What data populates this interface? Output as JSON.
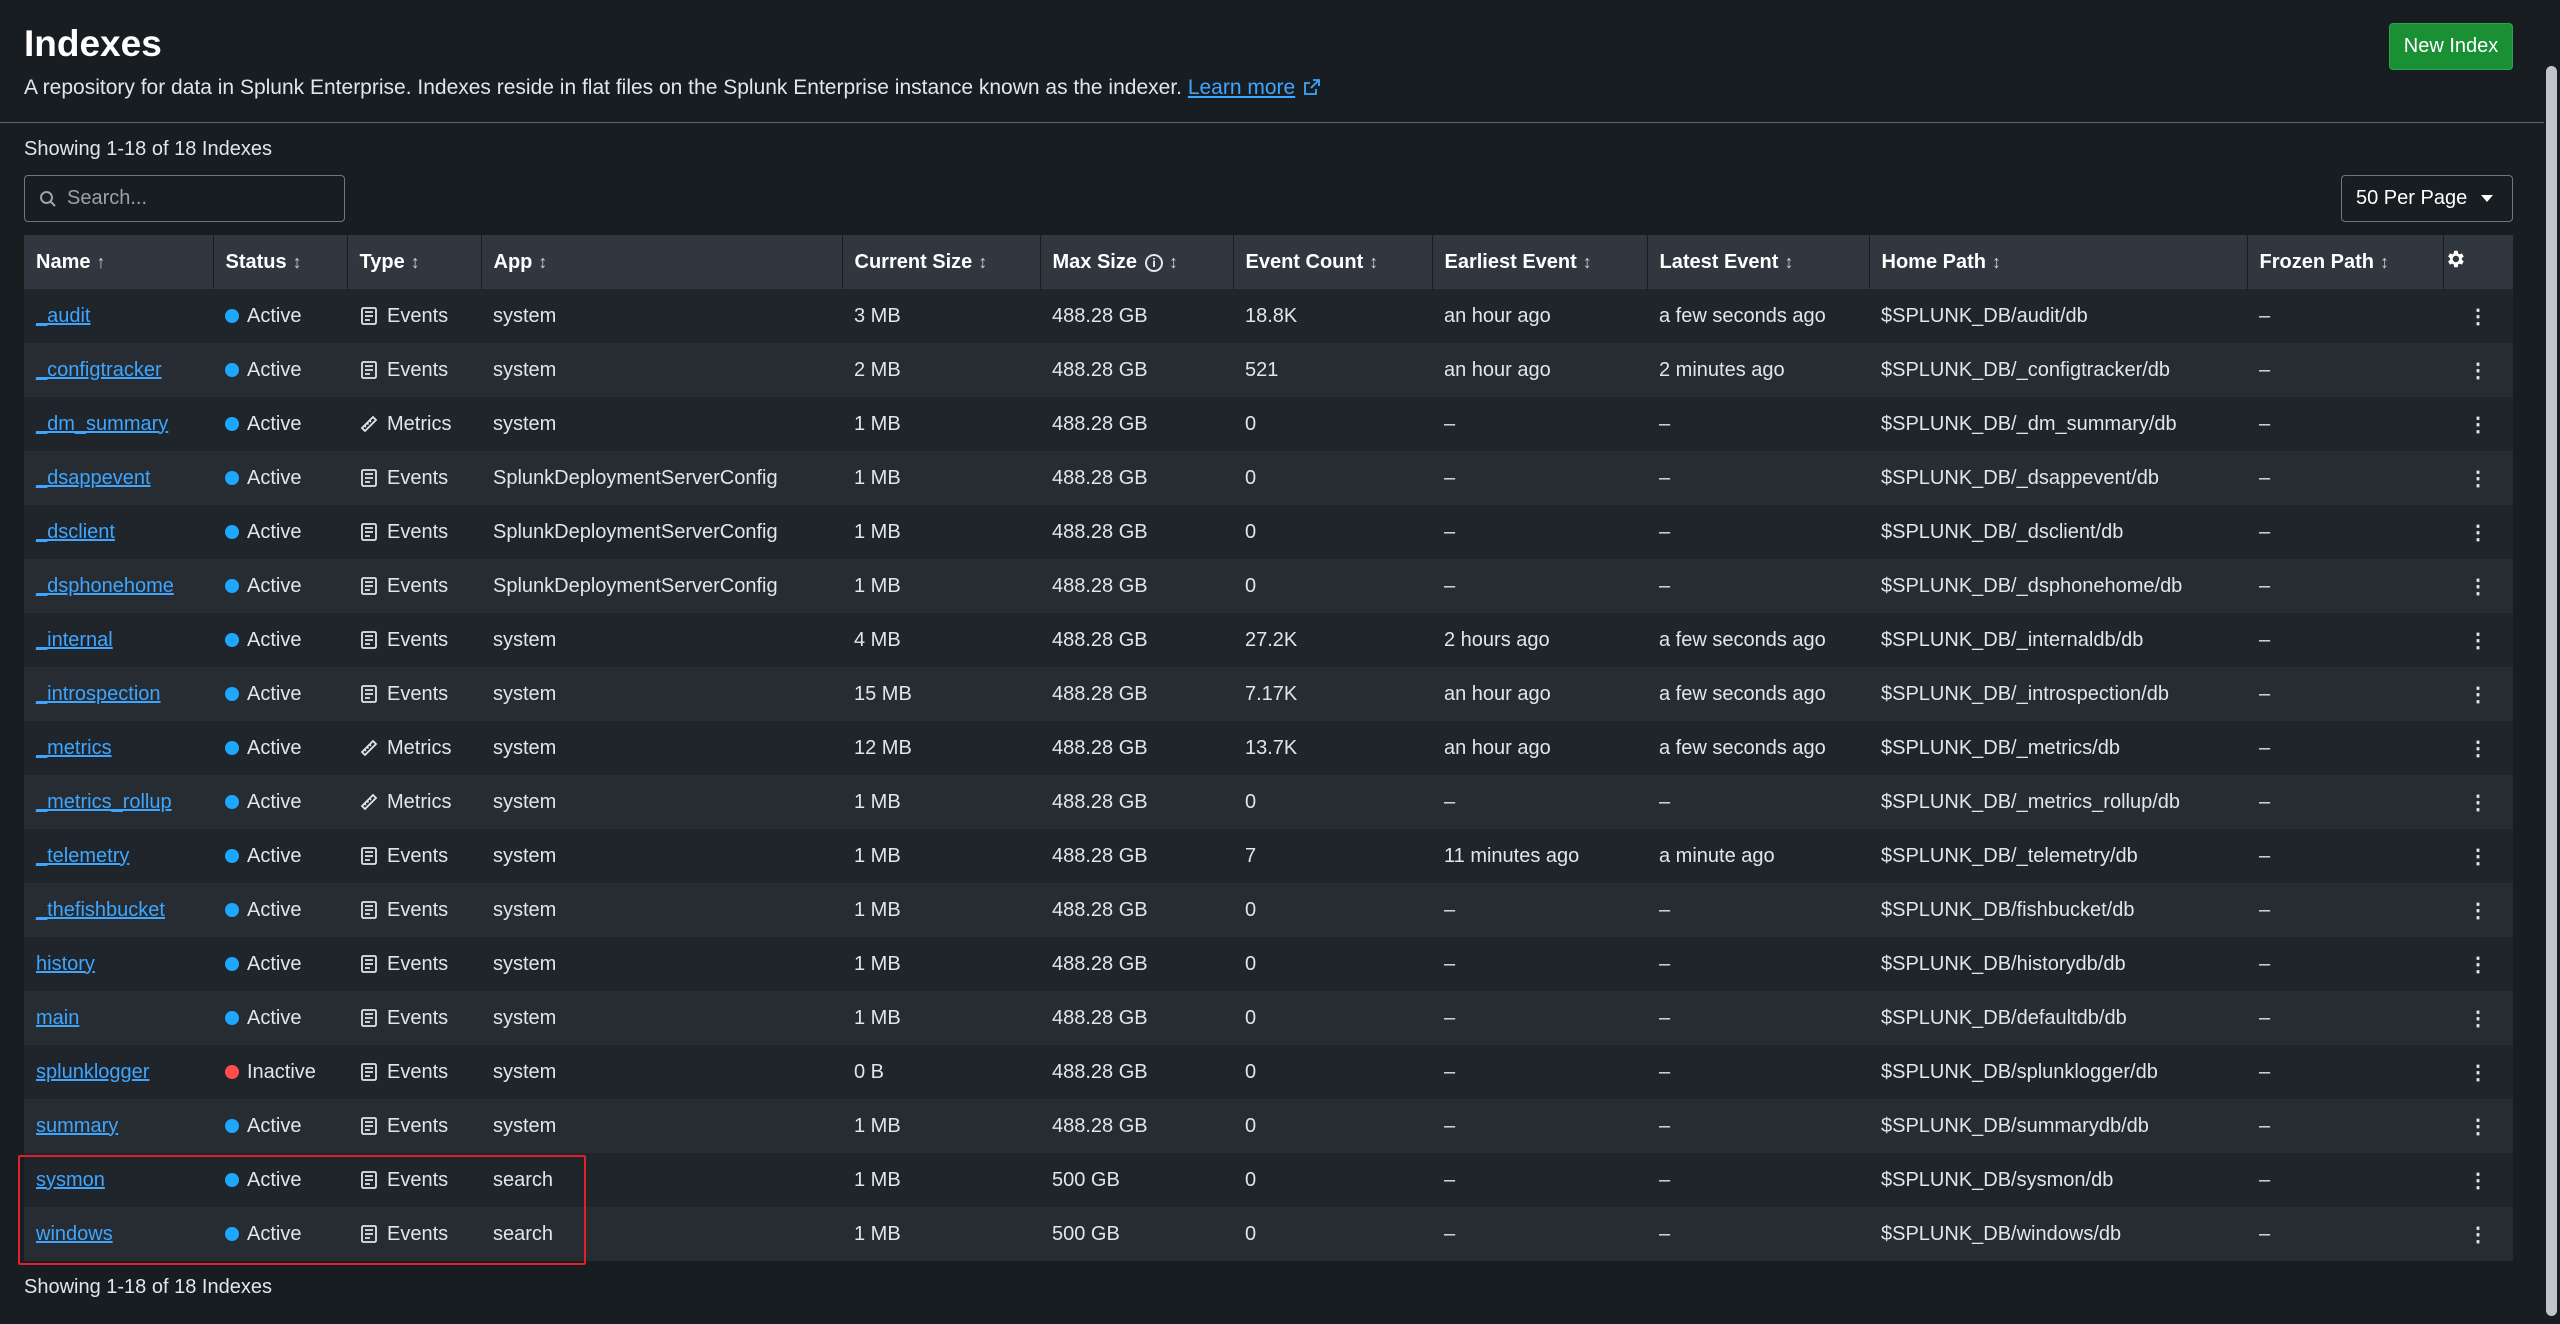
{
  "header": {
    "title": "Indexes",
    "subtitle": "A repository for data in Splunk Enterprise. Indexes reside in flat files on the Splunk Enterprise instance known as the indexer.",
    "learn_more": "Learn more",
    "new_index_label": "New Index"
  },
  "showing_text": "Showing 1-18 of 18 Indexes",
  "search": {
    "placeholder": "Search...",
    "value": ""
  },
  "per_page": {
    "selected": "50 Per Page"
  },
  "columns": {
    "name": "Name",
    "status": "Status",
    "type": "Type",
    "app": "App",
    "current_size": "Current Size",
    "max_size": "Max Size",
    "event_count": "Event Count",
    "earliest_event": "Earliest Event",
    "latest_event": "Latest Event",
    "home_path": "Home Path",
    "frozen_path": "Frozen Path"
  },
  "rows": [
    {
      "name": "_audit",
      "status": "Active",
      "type": "Events",
      "app": "system",
      "current_size": "3 MB",
      "max_size": "488.28 GB",
      "event_count": "18.8K",
      "earliest": "an hour ago",
      "latest": "a few seconds ago",
      "home_path": "$SPLUNK_DB/audit/db",
      "frozen_path": "–"
    },
    {
      "name": "_configtracker",
      "status": "Active",
      "type": "Events",
      "app": "system",
      "current_size": "2 MB",
      "max_size": "488.28 GB",
      "event_count": "521",
      "earliest": "an hour ago",
      "latest": "2 minutes ago",
      "home_path": "$SPLUNK_DB/_configtracker/db",
      "frozen_path": "–"
    },
    {
      "name": "_dm_summary",
      "status": "Active",
      "type": "Metrics",
      "app": "system",
      "current_size": "1 MB",
      "max_size": "488.28 GB",
      "event_count": "0",
      "earliest": "–",
      "latest": "–",
      "home_path": "$SPLUNK_DB/_dm_summary/db",
      "frozen_path": "–"
    },
    {
      "name": "_dsappevent",
      "status": "Active",
      "type": "Events",
      "app": "SplunkDeploymentServerConfig",
      "current_size": "1 MB",
      "max_size": "488.28 GB",
      "event_count": "0",
      "earliest": "–",
      "latest": "–",
      "home_path": "$SPLUNK_DB/_dsappevent/db",
      "frozen_path": "–"
    },
    {
      "name": "_dsclient",
      "status": "Active",
      "type": "Events",
      "app": "SplunkDeploymentServerConfig",
      "current_size": "1 MB",
      "max_size": "488.28 GB",
      "event_count": "0",
      "earliest": "–",
      "latest": "–",
      "home_path": "$SPLUNK_DB/_dsclient/db",
      "frozen_path": "–"
    },
    {
      "name": "_dsphonehome",
      "status": "Active",
      "type": "Events",
      "app": "SplunkDeploymentServerConfig",
      "current_size": "1 MB",
      "max_size": "488.28 GB",
      "event_count": "0",
      "earliest": "–",
      "latest": "–",
      "home_path": "$SPLUNK_DB/_dsphonehome/db",
      "frozen_path": "–"
    },
    {
      "name": "_internal",
      "status": "Active",
      "type": "Events",
      "app": "system",
      "current_size": "4 MB",
      "max_size": "488.28 GB",
      "event_count": "27.2K",
      "earliest": "2 hours ago",
      "latest": "a few seconds ago",
      "home_path": "$SPLUNK_DB/_internaldb/db",
      "frozen_path": "–"
    },
    {
      "name": "_introspection",
      "status": "Active",
      "type": "Events",
      "app": "system",
      "current_size": "15 MB",
      "max_size": "488.28 GB",
      "event_count": "7.17K",
      "earliest": "an hour ago",
      "latest": "a few seconds ago",
      "home_path": "$SPLUNK_DB/_introspection/db",
      "frozen_path": "–"
    },
    {
      "name": "_metrics",
      "status": "Active",
      "type": "Metrics",
      "app": "system",
      "current_size": "12 MB",
      "max_size": "488.28 GB",
      "event_count": "13.7K",
      "earliest": "an hour ago",
      "latest": "a few seconds ago",
      "home_path": "$SPLUNK_DB/_metrics/db",
      "frozen_path": "–"
    },
    {
      "name": "_metrics_rollup",
      "status": "Active",
      "type": "Metrics",
      "app": "system",
      "current_size": "1 MB",
      "max_size": "488.28 GB",
      "event_count": "0",
      "earliest": "–",
      "latest": "–",
      "home_path": "$SPLUNK_DB/_metrics_rollup/db",
      "frozen_path": "–"
    },
    {
      "name": "_telemetry",
      "status": "Active",
      "type": "Events",
      "app": "system",
      "current_size": "1 MB",
      "max_size": "488.28 GB",
      "event_count": "7",
      "earliest": "11 minutes ago",
      "latest": "a minute ago",
      "home_path": "$SPLUNK_DB/_telemetry/db",
      "frozen_path": "–"
    },
    {
      "name": "_thefishbucket",
      "status": "Active",
      "type": "Events",
      "app": "system",
      "current_size": "1 MB",
      "max_size": "488.28 GB",
      "event_count": "0",
      "earliest": "–",
      "latest": "–",
      "home_path": "$SPLUNK_DB/fishbucket/db",
      "frozen_path": "–"
    },
    {
      "name": "history",
      "status": "Active",
      "type": "Events",
      "app": "system",
      "current_size": "1 MB",
      "max_size": "488.28 GB",
      "event_count": "0",
      "earliest": "–",
      "latest": "–",
      "home_path": "$SPLUNK_DB/historydb/db",
      "frozen_path": "–"
    },
    {
      "name": "main",
      "status": "Active",
      "type": "Events",
      "app": "system",
      "current_size": "1 MB",
      "max_size": "488.28 GB",
      "event_count": "0",
      "earliest": "–",
      "latest": "–",
      "home_path": "$SPLUNK_DB/defaultdb/db",
      "frozen_path": "–"
    },
    {
      "name": "splunklogger",
      "status": "Inactive",
      "type": "Events",
      "app": "system",
      "current_size": "0 B",
      "max_size": "488.28 GB",
      "event_count": "0",
      "earliest": "–",
      "latest": "–",
      "home_path": "$SPLUNK_DB/splunklogger/db",
      "frozen_path": "–"
    },
    {
      "name": "summary",
      "status": "Active",
      "type": "Events",
      "app": "system",
      "current_size": "1 MB",
      "max_size": "488.28 GB",
      "event_count": "0",
      "earliest": "–",
      "latest": "–",
      "home_path": "$SPLUNK_DB/summarydb/db",
      "frozen_path": "–"
    },
    {
      "name": "sysmon",
      "status": "Active",
      "type": "Events",
      "app": "search",
      "current_size": "1 MB",
      "max_size": "500 GB",
      "event_count": "0",
      "earliest": "–",
      "latest": "–",
      "home_path": "$SPLUNK_DB/sysmon/db",
      "frozen_path": "–"
    },
    {
      "name": "windows",
      "status": "Active",
      "type": "Events",
      "app": "search",
      "current_size": "1 MB",
      "max_size": "500 GB",
      "event_count": "0",
      "earliest": "–",
      "latest": "–",
      "home_path": "$SPLUNK_DB/windows/db",
      "frozen_path": "–"
    }
  ],
  "colors": {
    "background": "#171d21",
    "header_row": "#31373e",
    "link": "#3ea6ff",
    "active_dot": "#1ea7fd",
    "inactive_dot": "#ff4b4b",
    "primary_button": "#1a9035",
    "highlight_box": "#e0202a"
  },
  "icons": {
    "events": "document-list-icon",
    "metrics": "ruler-icon",
    "search": "search-icon",
    "settings": "gear-icon",
    "row_actions": "kebab-icon",
    "external": "external-link-icon",
    "info": "info-icon"
  }
}
